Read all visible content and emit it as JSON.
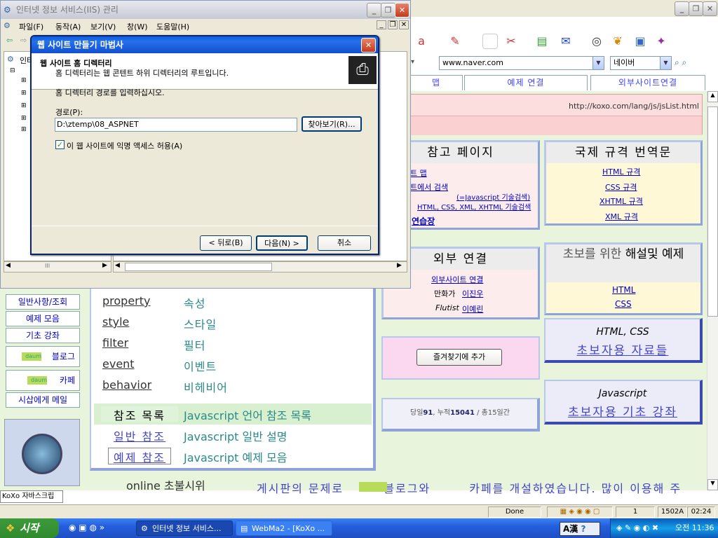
{
  "browser": {
    "address": "www.naver.com",
    "search_engine": "네이버",
    "nav_tabs": [
      "맵",
      "예제 연결",
      "외부사이트연결"
    ],
    "banner_url": "http://koxo.com/lang/js/jsList.html",
    "status_done": "Done",
    "status_page": "1",
    "status_size": "1502A",
    "status_time": "02:24"
  },
  "page": {
    "ref_page": {
      "title": "참고 페이지",
      "links": [
        "트 맵",
        "트에서 검색",
        "(=Javascript 기술검색)",
        "HTML, CSS, XML, XHTML 기술검색",
        "연습장"
      ]
    },
    "intl": {
      "title": "국제 규격 번역문",
      "links": [
        "HTML 규격",
        "CSS 규격",
        "XHTML 규격",
        "XML 규격"
      ]
    },
    "external": {
      "title": "외부 연결",
      "links": [
        "외부사이트 연결",
        "만화가",
        "이진우",
        "Flutist",
        "이예린"
      ]
    },
    "beginner": {
      "title_a": "초보를 위한",
      "title_b": "해설및 예제",
      "links": [
        "HTML",
        "CSS"
      ]
    },
    "bm_button": "즐겨찾기에 추가",
    "html_css_box": {
      "top": "HTML, CSS",
      "bottom": "초보자용 자료들"
    },
    "js_box": {
      "top": "Javascript",
      "bottom": "초보자용 기초 강좌"
    },
    "counter": {
      "prefix": "당일",
      "today": "91",
      "mid": ", 누적",
      "total": "15041",
      "suffix": " / 총15일간"
    },
    "sidebar": [
      "일반사항/조회",
      "예제 모음",
      "기초 강좌",
      "블로그",
      "카페",
      "시삽에게 메일"
    ],
    "terms": [
      {
        "en": "property",
        "ko": "속성"
      },
      {
        "en": "style",
        "ko": "스타일"
      },
      {
        "en": "filter",
        "ko": "필터"
      },
      {
        "en": "event",
        "ko": "이벤트"
      },
      {
        "en": "behavior",
        "ko": "비헤비어"
      }
    ],
    "refs": [
      {
        "label": "참조 목록",
        "desc": "Javascript 언어 참조 목록"
      },
      {
        "label": "일반 참조",
        "desc": "Javascript 일반 설명"
      },
      {
        "label": "예제 참조",
        "desc": "Javascript 예제 모음"
      }
    ],
    "bottom_left": "online 초불시위",
    "bottom_text": "게시판의 문제로",
    "bottom_blog": "블로그와",
    "bottom_cafe": "카페를 개설하였습니다. 많이 이용해 주",
    "daum_logo": "daum"
  },
  "status_bar_left": "KoXo 자바스크립",
  "iis": {
    "title": "인터넷 정보 서비스(IIS) 관리",
    "menu": [
      "파일(F)",
      "동작(A)",
      "보기(V)",
      "창(W)",
      "도움말(H)"
    ],
    "tree_label": "인터",
    "scroll_mark": "III"
  },
  "wizard": {
    "title": "웹 사이트 만들기 마법사",
    "header_title": "웹 사이트 홈 디렉터리",
    "header_sub": "홈 디렉터리는 웹 콘텐트 하위 디렉터리의 루트입니다.",
    "prompt": "홈 디렉터리 경로를 입력하십시오.",
    "path_label": "경로(P):",
    "path_value": "D:\\ztemp\\08_ASPNET",
    "browse_button": "찾아보기(R)...",
    "checkbox_label": "이 웹 사이트에 익명 액세스 허용(A)",
    "back_button": "< 뒤로(B)",
    "next_button": "다음(N) >",
    "cancel_button": "취소"
  },
  "taskbar": {
    "start": "시작",
    "btn1": "인터넷 정보 서비스...",
    "btn2": "WebMa2 - [KoXo ...",
    "ime": "A漢",
    "time": "오전 11:36"
  },
  "colors": {
    "accent": "#0a246a",
    "link": "#0000cc",
    "page_bg": "#e9f4dc"
  }
}
